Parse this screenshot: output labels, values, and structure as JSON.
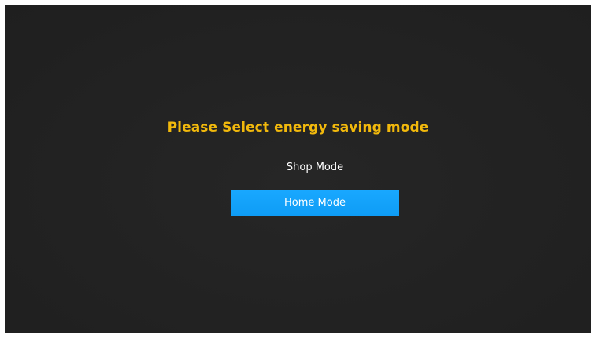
{
  "dialog": {
    "title": "Please Select energy saving mode",
    "options": [
      {
        "label": "Shop Mode",
        "selected": false
      },
      {
        "label": "Home Mode",
        "selected": true
      }
    ]
  },
  "colors": {
    "background": "#222222",
    "title": "#f2b90c",
    "option_text": "#ffffff",
    "highlight": "#0e9cf5"
  }
}
